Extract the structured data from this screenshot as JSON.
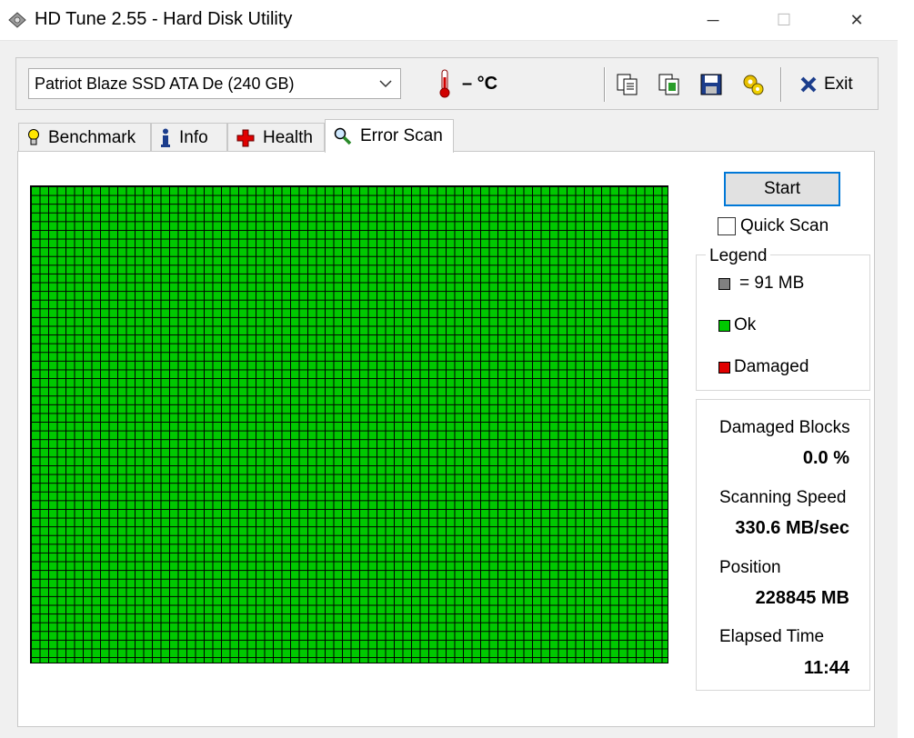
{
  "window": {
    "title": "HD Tune 2.55 - Hard Disk Utility",
    "minimize": "─",
    "maximize": "☐",
    "close": "✕"
  },
  "toolbar": {
    "drive": "Patriot Blaze SSD ATA De (240 GB)",
    "temperature": "– °C",
    "exit_label": "Exit",
    "icons": [
      "copy-text-icon",
      "copy-screenshot-icon",
      "save-icon",
      "options-icon"
    ]
  },
  "tabs": [
    {
      "label": "Benchmark",
      "icon": "lightbulb-icon"
    },
    {
      "label": "Info",
      "icon": "info-icon"
    },
    {
      "label": "Health",
      "icon": "health-cross-icon"
    },
    {
      "label": "Error Scan",
      "icon": "magnifier-icon",
      "active": true
    }
  ],
  "scan": {
    "start_label": "Start",
    "quick_scan_label": "Quick Scan",
    "quick_scan_checked": false,
    "grid_color_ok": "#00c800"
  },
  "legend": {
    "title": "Legend",
    "items": [
      {
        "label": "= 91 MB",
        "color": "#808080"
      },
      {
        "label": "Ok",
        "color": "#00c800"
      },
      {
        "label": "Damaged",
        "color": "#e00000"
      }
    ]
  },
  "stats": {
    "damaged_blocks_label": "Damaged Blocks",
    "damaged_blocks_value": "0.0 %",
    "scanning_speed_label": "Scanning Speed",
    "scanning_speed_value": "330.6 MB/sec",
    "position_label": "Position",
    "position_value": "228845 MB",
    "elapsed_time_label": "Elapsed Time",
    "elapsed_time_value": "11:44"
  }
}
